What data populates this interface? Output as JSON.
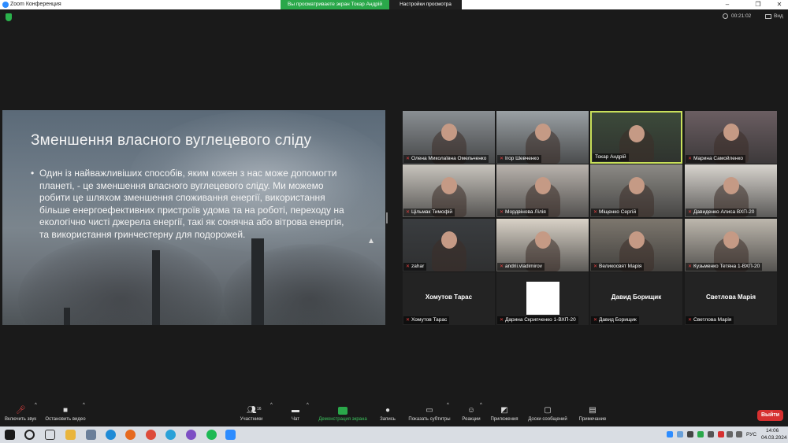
{
  "window": {
    "title": "Zoom Конференция",
    "share_banner": "Вы просматриваете экран Токар Андрій",
    "view_options": "Настройки просмотра"
  },
  "infobar": {
    "timer": "00:21:02",
    "view_label": "Вид"
  },
  "slide": {
    "title": "Зменшення власного вуглецевого сліду",
    "bullet": "•",
    "body": "Один із найважливіших способів, яким кожен з нас може допомогти планеті, - це зменшення власного вуглецевого сліду. Ми можемо робити це шляхом зменшення споживання енергії, використання більше енергоефективних пристроїв удома та на роботі, переходу на екологічно чисті джерела енергії, такі як сонячна або вітрова енергія, та використання гринчестерну для подорожей."
  },
  "participants": [
    {
      "name": "Олена Миколаївна Омельченко",
      "muted": true,
      "video": true,
      "bg": "#8a8f93"
    },
    {
      "name": "Ігор Шевченко",
      "muted": true,
      "video": true,
      "bg": "#9aa0a4"
    },
    {
      "name": "Токар Андрій",
      "muted": false,
      "video": true,
      "bg": "#3c4a3a",
      "active": true
    },
    {
      "name": "Марина Самойленко",
      "muted": true,
      "video": true,
      "bg": "#6b5e62"
    },
    {
      "name": "Цільмак Тимофій",
      "muted": true,
      "video": true,
      "bg": "#c8c4bd"
    },
    {
      "name": "Мордвінова Лілія",
      "muted": true,
      "video": true,
      "bg": "#b9b3ad"
    },
    {
      "name": "Міщенко Сергій",
      "muted": true,
      "video": true,
      "bg": "#8c8a85"
    },
    {
      "name": "Давиденко Алиса ВХП-20",
      "muted": true,
      "video": true,
      "bg": "#d8d4ce"
    },
    {
      "name": "zahar",
      "muted": true,
      "video": true,
      "bg": "#3a3d40"
    },
    {
      "name": "andrii.vladimirov",
      "muted": true,
      "video": true,
      "bg": "#d9d2c7"
    },
    {
      "name": "Великосвят Марія",
      "muted": true,
      "video": true,
      "bg": "#7d776e"
    },
    {
      "name": "Кузьменко Тетяна 1-ВХП-20",
      "muted": true,
      "video": true,
      "bg": "#bdb7ad"
    },
    {
      "name": "Хомутов Тарас",
      "muted": true,
      "video": false,
      "display": "Хомутов Тарас"
    },
    {
      "name": "Дарина Скрипченко 1-ВХП-20",
      "muted": true,
      "video": false,
      "white_avatar": true
    },
    {
      "name": "Давид Борищик",
      "muted": true,
      "video": false,
      "display": "Давид Борищик"
    },
    {
      "name": "Светлова Марія",
      "muted": true,
      "video": false,
      "display": "Светлова Марія"
    }
  ],
  "toolbar": {
    "unmute": "Включить звук",
    "stop_video": "Остановить видео",
    "participants": "Участники",
    "participants_count": "16",
    "chat": "Чат",
    "share_screen": "Демонстрация экрана",
    "record": "Запись",
    "captions": "Показать субтитры",
    "reactions": "Реакции",
    "apps": "Приложения",
    "whiteboards": "Доски сообщений",
    "notes": "Примечание",
    "leave": "Выйти"
  },
  "taskbar": {
    "language": "РУС",
    "time": "14:06",
    "date": "04.03.2024"
  },
  "colors": {
    "zoom_blue": "#2d8cff",
    "share_green": "#2aa84a",
    "leave_red": "#d63030",
    "active_speaker": "#c9e05b"
  }
}
